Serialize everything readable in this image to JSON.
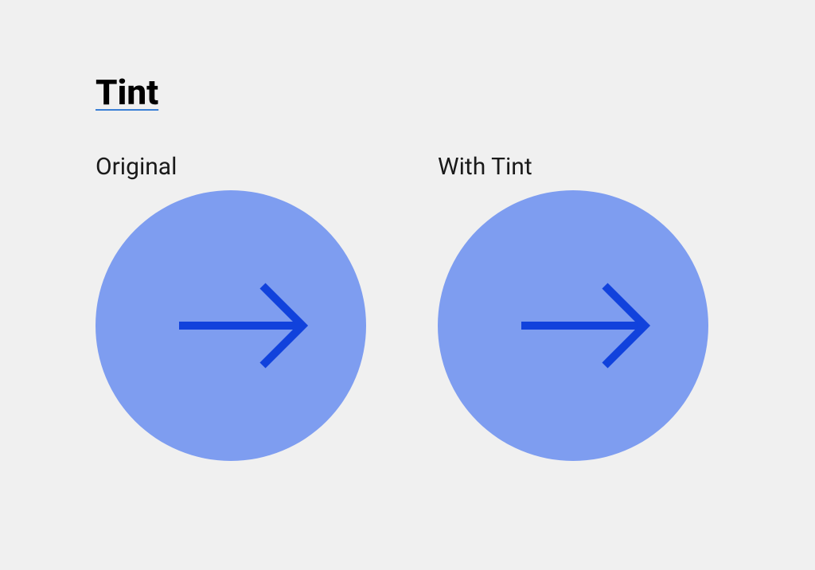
{
  "title": "Tint",
  "examples": [
    {
      "label": "Original"
    },
    {
      "label": "With Tint"
    }
  ],
  "colors": {
    "background": "#f0f0f0",
    "circle": "#7e9df0",
    "arrow": "#1142dc",
    "underline": "#3a7fd5"
  }
}
